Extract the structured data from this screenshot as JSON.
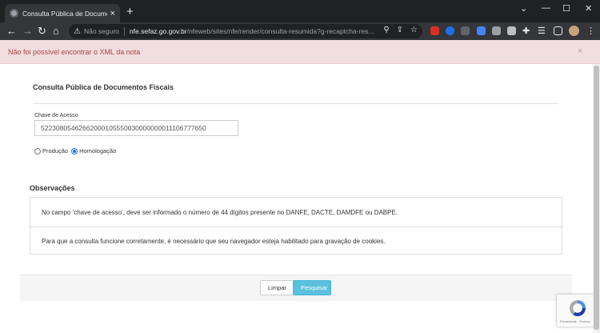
{
  "browser": {
    "tab_title": "Consulta Pública de Documentos Fiscais",
    "tab_close": "×",
    "new_tab": "+",
    "insecure_label": "Não seguro",
    "url_host": "nfe.sefaz.go.gov.br",
    "url_path": "/nfeweb/sites/nfe/render/consulta-resumida?g-recaptcha-res...",
    "window_controls": [
      "⌄",
      "—",
      "☐",
      "✕"
    ]
  },
  "alert": {
    "message": "Não foi possível encontrar o XML da nota",
    "close": "×"
  },
  "form": {
    "title": "Consulta Pública de Documentos Fiscais",
    "chave_label": "Chave de Acesso",
    "chave_value": "52230805462662000105550030000000011106777650",
    "environment_options": [
      {
        "label": "Produção",
        "checked": false
      },
      {
        "label": "Homologação",
        "checked": true
      }
    ]
  },
  "observacoes": {
    "title": "Observações",
    "items": [
      "No campo 'chave de acesso', deve ser informado o número de 44 dígitos presente no DANFE, DACTE, DAMDFE ou DABPE.",
      "Para que a consulta funcione corretamente, é necessário que seu navegador esteja habilitado para gravação de cookies."
    ]
  },
  "actions": {
    "limpar": "Limpar",
    "pesquisar": "Pesquisar"
  },
  "recaptcha": {
    "footer_text": "Privacidade - Termos"
  }
}
